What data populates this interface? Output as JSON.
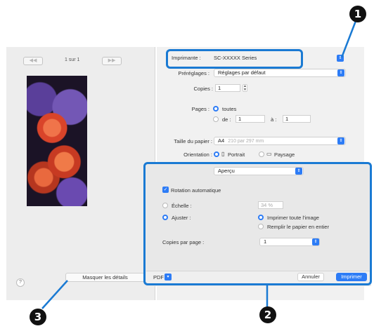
{
  "preview": {
    "prev_button": "◀◀",
    "next_button": "▶▶",
    "page_counter": "1 sur 1",
    "help_label": "?",
    "hide_details_button": "Masquer les détails"
  },
  "printer": {
    "label": "Imprimante :",
    "value": "SC-XXXXX Series"
  },
  "presets": {
    "label": "Préréglages :",
    "value": "Réglages par défaut"
  },
  "copies": {
    "label": "Copies :",
    "value": "1"
  },
  "pages": {
    "label": "Pages :",
    "all_label": "toutes",
    "from_label": "de :",
    "from_value": "1",
    "to_label": "à :",
    "to_value": "1"
  },
  "paper_size": {
    "label": "Taille du papier :",
    "value": "A4",
    "dimensions": "210 par 297 mm"
  },
  "orientation": {
    "label": "Orientation :",
    "portrait_label": "Portrait",
    "landscape_label": "Paysage"
  },
  "panel_select": {
    "value": "Aperçu"
  },
  "options": {
    "auto_rotate_label": "Rotation automatique",
    "scale_label": "Échelle :",
    "scale_value": "34 %",
    "fit_label": "Ajuster :",
    "print_entire_label": "Imprimer toute l'image",
    "fill_paper_label": "Remplir le papier en entier",
    "copies_per_page_label": "Copies par page :",
    "copies_per_page_value": "1"
  },
  "footer": {
    "pdf_label": "PDF",
    "cancel_label": "Annuler",
    "print_label": "Imprimer"
  },
  "callouts": {
    "one": "1",
    "two": "2",
    "three": "3"
  },
  "colors": {
    "accent": "#2d7cf6",
    "callout_frame": "#1a7ad3"
  }
}
